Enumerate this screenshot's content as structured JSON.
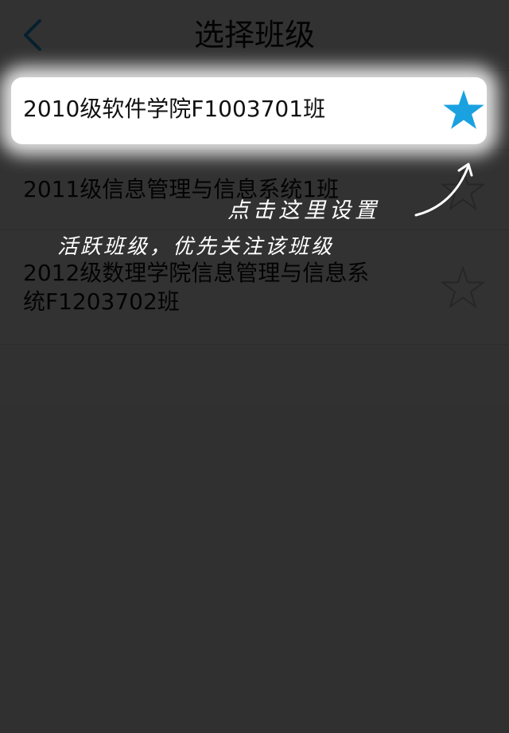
{
  "header": {
    "title": "选择班级",
    "back_icon": "chevron-left-icon"
  },
  "classes": [
    {
      "label": "2010级软件学院F1003701班",
      "starred": true
    },
    {
      "label": "2011级信息管理与信息系统1班",
      "starred": false
    },
    {
      "label": "2012级数理学院信息管理与信息系统F1203702班",
      "starred": false
    }
  ],
  "tip": {
    "line1": "点击这里设置",
    "line2": "活跃班级，优先关注该班级",
    "arrow_icon": "curved-arrow-icon"
  },
  "colors": {
    "accent": "#1aa1e0",
    "star_outline": "#bdbdbd",
    "overlay": "rgba(0,0,0,0.80)"
  }
}
